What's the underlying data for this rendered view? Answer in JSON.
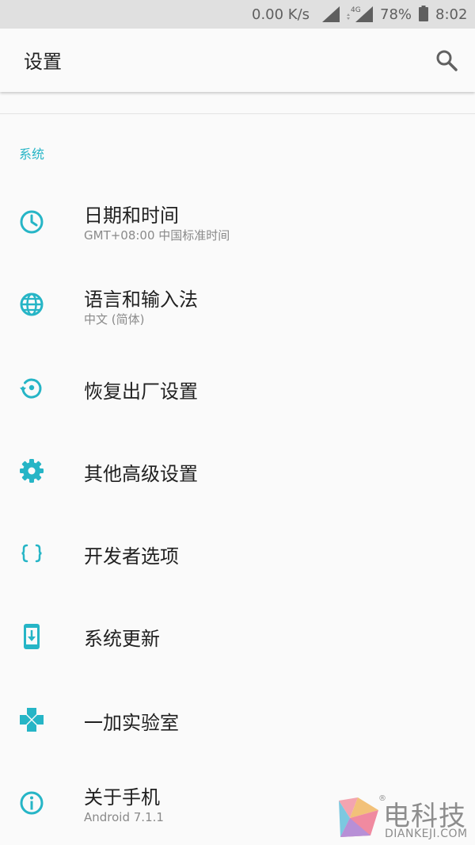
{
  "status_bar": {
    "net_speed": "0.00 K/s",
    "signal_label": "4G",
    "battery": "78%",
    "time": "8:02"
  },
  "app_bar": {
    "title": "设置",
    "search_icon": "search-icon"
  },
  "section": {
    "label": "系统"
  },
  "items": [
    {
      "title": "日期和时间",
      "subtitle": "GMT+08:00 中国标准时间",
      "icon": "clock-icon"
    },
    {
      "title": "语言和输入法",
      "subtitle": "中文 (简体)",
      "icon": "globe-icon"
    },
    {
      "title": "恢复出厂设置",
      "subtitle": "",
      "icon": "restore-icon"
    },
    {
      "title": "其他高级设置",
      "subtitle": "",
      "icon": "gear-icon"
    },
    {
      "title": "开发者选项",
      "subtitle": "",
      "icon": "braces-icon"
    },
    {
      "title": "系统更新",
      "subtitle": "",
      "icon": "system-update-icon"
    },
    {
      "title": "一加实验室",
      "subtitle": "",
      "icon": "gamepad-icon"
    },
    {
      "title": "关于手机",
      "subtitle": "Android 7.1.1",
      "icon": "info-icon"
    }
  ],
  "watermark": {
    "name": "电科技",
    "url": "DIANKEJI.COM",
    "reg": "®"
  },
  "colors": {
    "accent": "#26b5c6",
    "status_bar_bg": "#e0e0e0",
    "background": "#fafafa",
    "primary_text": "#212121",
    "secondary_text": "#8a8a8a"
  }
}
